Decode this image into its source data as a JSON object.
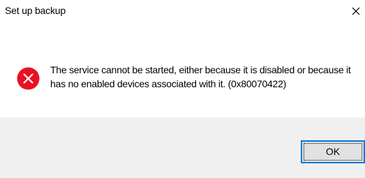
{
  "window": {
    "title": "Set up backup",
    "close_icon": "close-icon"
  },
  "message": {
    "icon": "error-icon",
    "icon_color": "#e81123",
    "line1": "The service cannot be started, either because it is disabled or because it",
    "line2": "has no enabled devices associated with it. (0x80070422)"
  },
  "footer": {
    "ok_label": "OK",
    "accent": "#0078d7"
  }
}
